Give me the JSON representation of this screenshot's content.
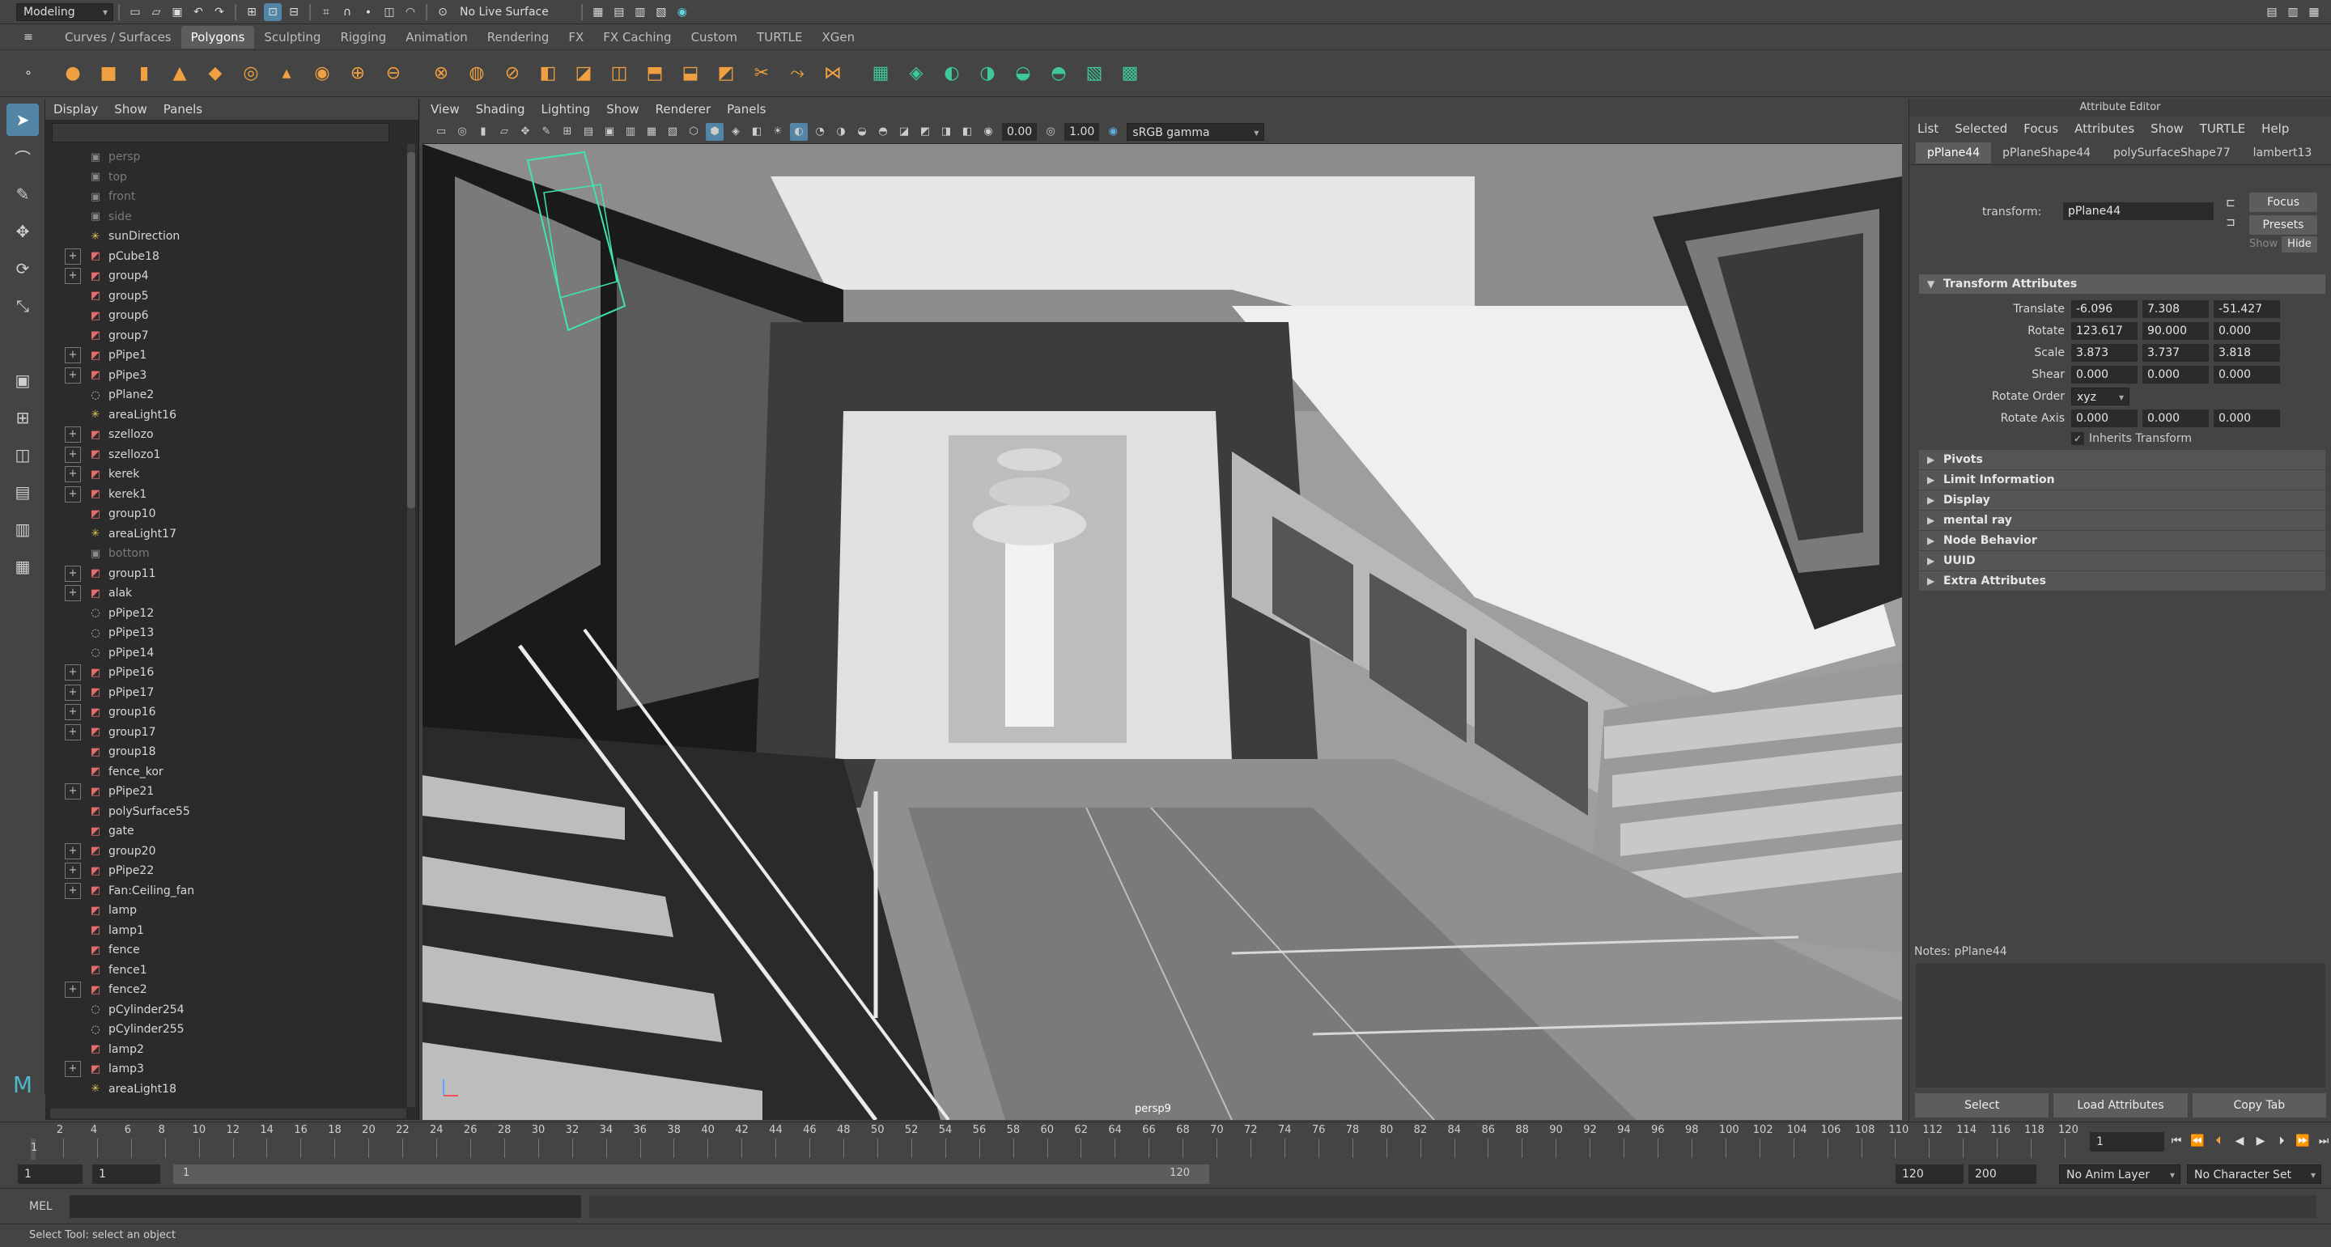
{
  "statusline": {
    "menu_set": "Modeling",
    "live_surface": "No Live Surface"
  },
  "shelf": {
    "tabs": [
      "Curves / Surfaces",
      "Polygons",
      "Sculpting",
      "Rigging",
      "Animation",
      "Rendering",
      "FX",
      "FX Caching",
      "Custom",
      "TURTLE",
      "XGen"
    ],
    "active_tab": "Polygons",
    "icons": [
      "sphere-icon",
      "cube-icon",
      "cylinder-icon",
      "cone-icon",
      "plane-icon",
      "torus-icon",
      "pyramid-icon",
      "pipe-icon",
      "combine-icon",
      "separate-icon",
      "extract-icon",
      "smooth-icon",
      "boolean-icon",
      "mirror-icon",
      "bevel-icon",
      "bridge-icon",
      "extrude-icon",
      "append-icon",
      "fill-hole-icon",
      "multicut-icon",
      "target-weld-icon",
      "merge-icon",
      "uv-editor-icon",
      "planar-map-icon",
      "cylindrical-map-icon",
      "spherical-map-icon",
      "automatic-map-icon",
      "unfold-icon",
      "layout-icon",
      "checker-icon"
    ]
  },
  "outliner": {
    "menu": [
      "Display",
      "Show",
      "Panels"
    ],
    "items": [
      {
        "label": "persp",
        "type": "camera",
        "expand": false,
        "dim": true
      },
      {
        "label": "top",
        "type": "camera",
        "expand": false,
        "dim": true
      },
      {
        "label": "front",
        "type": "camera",
        "expand": false,
        "dim": true
      },
      {
        "label": "side",
        "type": "camera",
        "expand": false,
        "dim": true
      },
      {
        "label": "sunDirection",
        "type": "light",
        "expand": false,
        "dim": false
      },
      {
        "label": "pCube18",
        "type": "mesh",
        "expand": true,
        "dim": false
      },
      {
        "label": "group4",
        "type": "mesh",
        "expand": true,
        "dim": false
      },
      {
        "label": "group5",
        "type": "mesh",
        "expand": false,
        "dim": false
      },
      {
        "label": "group6",
        "type": "mesh",
        "expand": false,
        "dim": false
      },
      {
        "label": "group7",
        "type": "mesh",
        "expand": false,
        "dim": false
      },
      {
        "label": "pPipe1",
        "type": "mesh",
        "expand": true,
        "dim": false
      },
      {
        "label": "pPipe3",
        "type": "mesh",
        "expand": true,
        "dim": false
      },
      {
        "label": "pPlane2",
        "type": "shape",
        "expand": false,
        "dim": false
      },
      {
        "label": "areaLight16",
        "type": "light",
        "expand": false,
        "dim": false
      },
      {
        "label": "szellozo",
        "type": "mesh",
        "expand": true,
        "dim": false
      },
      {
        "label": "szellozo1",
        "type": "mesh",
        "expand": true,
        "dim": false
      },
      {
        "label": "kerek",
        "type": "mesh",
        "expand": true,
        "dim": false
      },
      {
        "label": "kerek1",
        "type": "mesh",
        "expand": true,
        "dim": false
      },
      {
        "label": "group10",
        "type": "mesh",
        "expand": false,
        "dim": false
      },
      {
        "label": "areaLight17",
        "type": "light",
        "expand": false,
        "dim": false
      },
      {
        "label": "bottom",
        "type": "camera",
        "expand": false,
        "dim": true
      },
      {
        "label": "group11",
        "type": "mesh",
        "expand": true,
        "dim": false
      },
      {
        "label": "alak",
        "type": "mesh",
        "expand": true,
        "dim": false
      },
      {
        "label": "pPipe12",
        "type": "shape",
        "expand": false,
        "dim": false
      },
      {
        "label": "pPipe13",
        "type": "shape",
        "expand": false,
        "dim": false
      },
      {
        "label": "pPipe14",
        "type": "shape",
        "expand": false,
        "dim": false
      },
      {
        "label": "pPipe16",
        "type": "mesh",
        "expand": true,
        "dim": false
      },
      {
        "label": "pPipe17",
        "type": "mesh",
        "expand": true,
        "dim": false
      },
      {
        "label": "group16",
        "type": "mesh",
        "expand": true,
        "dim": false
      },
      {
        "label": "group17",
        "type": "mesh",
        "expand": true,
        "dim": false
      },
      {
        "label": "group18",
        "type": "mesh",
        "expand": false,
        "dim": false
      },
      {
        "label": "fence_kor",
        "type": "mesh",
        "expand": false,
        "dim": false
      },
      {
        "label": "pPipe21",
        "type": "mesh",
        "expand": true,
        "dim": false
      },
      {
        "label": "polySurface55",
        "type": "mesh",
        "expand": false,
        "dim": false
      },
      {
        "label": "gate",
        "type": "mesh",
        "expand": false,
        "dim": false
      },
      {
        "label": "group20",
        "type": "mesh",
        "expand": true,
        "dim": false
      },
      {
        "label": "pPipe22",
        "type": "mesh",
        "expand": true,
        "dim": false
      },
      {
        "label": "Fan:Ceiling_fan",
        "type": "mesh",
        "expand": true,
        "dim": false
      },
      {
        "label": "lamp",
        "type": "mesh",
        "expand": false,
        "dim": false
      },
      {
        "label": "lamp1",
        "type": "mesh",
        "expand": false,
        "dim": false
      },
      {
        "label": "fence",
        "type": "mesh",
        "expand": false,
        "dim": false
      },
      {
        "label": "fence1",
        "type": "mesh",
        "expand": false,
        "dim": false
      },
      {
        "label": "fence2",
        "type": "mesh",
        "expand": true,
        "dim": false
      },
      {
        "label": "pCylinder254",
        "type": "shape",
        "expand": false,
        "dim": false
      },
      {
        "label": "pCylinder255",
        "type": "shape",
        "expand": false,
        "dim": false
      },
      {
        "label": "lamp2",
        "type": "mesh",
        "expand": false,
        "dim": false
      },
      {
        "label": "lamp3",
        "type": "mesh",
        "expand": true,
        "dim": false
      },
      {
        "label": "areaLight18",
        "type": "light",
        "expand": false,
        "dim": false
      }
    ]
  },
  "viewport": {
    "menu": [
      "View",
      "Shading",
      "Lighting",
      "Show",
      "Renderer",
      "Panels"
    ],
    "exposure": "0.00",
    "gamma": "1.00",
    "color_space": "sRGB gamma",
    "camera": "persp9"
  },
  "attribute_editor": {
    "title": "Attribute Editor",
    "menu": [
      "List",
      "Selected",
      "Focus",
      "Attributes",
      "Show",
      "TURTLE",
      "Help"
    ],
    "tabs": [
      "pPlane44",
      "pPlaneShape44",
      "polySurfaceShape77",
      "lambert13"
    ],
    "active_tab": "pPlane44",
    "transform_label": "transform:",
    "transform_value": "pPlane44",
    "focus_btn": "Focus",
    "presets_btn": "Presets",
    "show_label": "Show",
    "hide_btn": "Hide",
    "section_title": "Transform Attributes",
    "translate": {
      "label": "Translate",
      "values": [
        "-6.096",
        "7.308",
        "-51.427"
      ]
    },
    "rotate": {
      "label": "Rotate",
      "values": [
        "123.617",
        "90.000",
        "0.000"
      ]
    },
    "scale": {
      "label": "Scale",
      "values": [
        "3.873",
        "3.737",
        "3.818"
      ]
    },
    "shear": {
      "label": "Shear",
      "values": [
        "0.000",
        "0.000",
        "0.000"
      ]
    },
    "rotate_order": {
      "label": "Rotate Order",
      "value": "xyz"
    },
    "rotate_axis": {
      "label": "Rotate Axis",
      "values": [
        "0.000",
        "0.000",
        "0.000"
      ]
    },
    "inherits": "Inherits Transform",
    "collapsed_sections": [
      "Pivots",
      "Limit Information",
      "Display",
      "mental ray",
      "Node Behavior",
      "UUID",
      "Extra Attributes"
    ],
    "notes_label": "Notes:  pPlane44",
    "bottom_buttons": [
      "Select",
      "Load Attributes",
      "Copy Tab"
    ]
  },
  "timeline": {
    "ticks": [
      "2",
      "4",
      "6",
      "8",
      "10",
      "12",
      "14",
      "16",
      "18",
      "20",
      "22",
      "24",
      "26",
      "28",
      "30",
      "32",
      "34",
      "36",
      "38",
      "40",
      "42",
      "44",
      "46",
      "48",
      "50",
      "52",
      "54",
      "56",
      "58",
      "60",
      "62",
      "64",
      "66",
      "68",
      "70",
      "72",
      "74",
      "76",
      "78",
      "80",
      "82",
      "84",
      "86",
      "88",
      "90",
      "92",
      "94",
      "96",
      "98",
      "100",
      "102",
      "104",
      "106",
      "108",
      "110",
      "112",
      "114",
      "116",
      "118",
      "120"
    ],
    "current_frame": "1",
    "current_marker": "1"
  },
  "range": {
    "start": "1",
    "range_start": "1",
    "slider_start": "1",
    "slider_end": "120",
    "range_end": "120",
    "end": "200",
    "anim_layer": "No Anim Layer",
    "character_set": "No Character Set"
  },
  "command_line": {
    "label": "MEL"
  },
  "help_line": "Select Tool: select an object"
}
